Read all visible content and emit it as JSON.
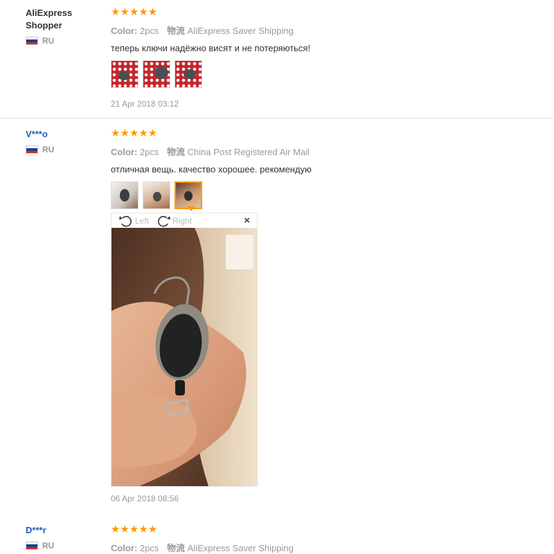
{
  "reviews": [
    {
      "user": "AliExpress Shopper",
      "country": "RU",
      "stars": "★★★★★",
      "color_label": "Color:",
      "color_value": "2pcs",
      "shipping_cn": "物流",
      "shipping": "AliExpress Saver Shipping",
      "comment": "теперь ключи надёжно висят и не потеряються!",
      "date": "21 Apr 2018 03:12"
    },
    {
      "user": "V***o",
      "country": "RU",
      "stars": "★★★★★",
      "color_label": "Color:",
      "color_value": "2pcs",
      "shipping_cn": "物流",
      "shipping": "China Post Registered Air Mail",
      "comment": "отличная вещь. качество хорошее. рекомендую",
      "date": "06 Apr 2018 08:56"
    },
    {
      "user": "D***r",
      "country": "RU",
      "stars": "★★★★★",
      "color_label": "Color:",
      "color_value": "2pcs",
      "shipping_cn": "物流",
      "shipping": "AliExpress Saver Shipping"
    }
  ],
  "viewer": {
    "rotate_left": "Left",
    "rotate_right": "Right",
    "close": "×"
  },
  "colors": {
    "star": "#ff9900",
    "username_link": "#1b5fb8",
    "muted": "#999999",
    "active_border": "#ff9900"
  }
}
